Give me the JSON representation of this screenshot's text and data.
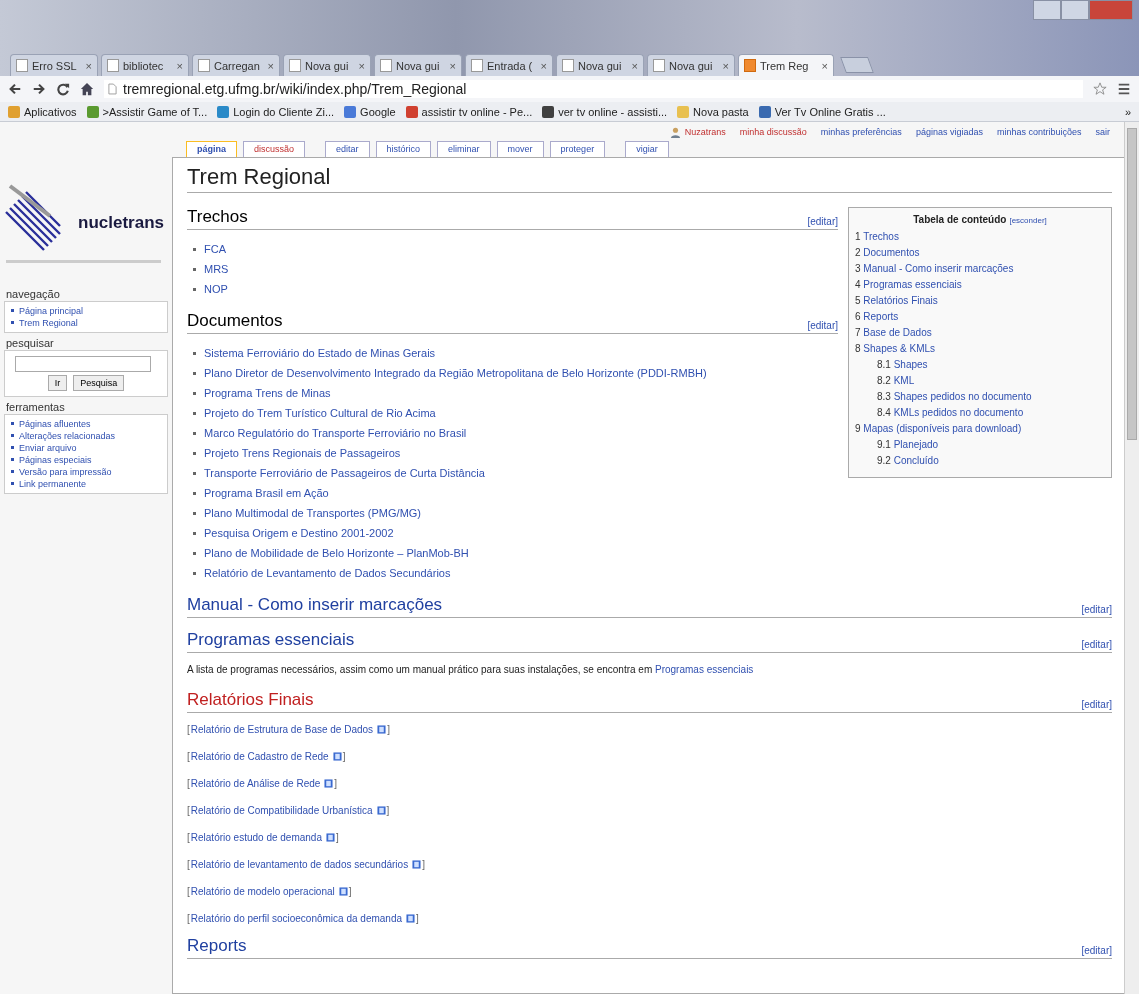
{
  "browser": {
    "tabs": [
      {
        "label": "Erro SSL",
        "selected": false
      },
      {
        "label": "bibliotec",
        "selected": false
      },
      {
        "label": "Carregan",
        "selected": false
      },
      {
        "label": "Nova gui",
        "selected": false
      },
      {
        "label": "Nova gui",
        "selected": false
      },
      {
        "label": "Entrada (",
        "selected": false
      },
      {
        "label": "Nova gui",
        "selected": false
      },
      {
        "label": "Nova gui",
        "selected": false
      },
      {
        "label": "Trem Reg",
        "selected": true
      }
    ],
    "close_mark": "×",
    "url": "tremregional.etg.ufmg.br/wiki/index.php/Trem_Regional",
    "bookmarks": [
      {
        "label": "Aplicativos",
        "color": "#e0a030"
      },
      {
        "label": ">Assistir Game of T...",
        "color": "#5a9a30"
      },
      {
        "label": "Login do Cliente Zi...",
        "color": "#2a8ac8"
      },
      {
        "label": "Google",
        "color": "#4a7ad8"
      },
      {
        "label": "assistir tv online - Pe...",
        "color": "#d04030"
      },
      {
        "label": "ver tv online - assisti...",
        "color": "#404040"
      },
      {
        "label": "Nova pasta",
        "color": "#e8c050"
      },
      {
        "label": "Ver Tv Online Gratis ...",
        "color": "#3a6ab0"
      }
    ],
    "more": "»"
  },
  "personal": [
    {
      "label": "Nuzatrans",
      "missing": true
    },
    {
      "label": "minha discussão",
      "missing": true
    },
    {
      "label": "minhas preferências",
      "missing": false
    },
    {
      "label": "páginas vigiadas",
      "missing": false
    },
    {
      "label": "minhas contribuições",
      "missing": false
    },
    {
      "label": "sair",
      "missing": false
    }
  ],
  "page_tabs": [
    [
      {
        "label": "página",
        "selected": true,
        "missing": false
      },
      {
        "label": "discussão",
        "selected": false,
        "missing": true
      }
    ],
    [
      {
        "label": "editar",
        "selected": false,
        "missing": false
      },
      {
        "label": "histórico",
        "selected": false,
        "missing": false
      },
      {
        "label": "eliminar",
        "selected": false,
        "missing": false
      },
      {
        "label": "mover",
        "selected": false,
        "missing": false
      },
      {
        "label": "proteger",
        "selected": false,
        "missing": false
      }
    ],
    [
      {
        "label": "vigiar",
        "selected": false,
        "missing": false
      }
    ]
  ],
  "logo": {
    "name": "nucletrans"
  },
  "sidebar": [
    {
      "title": "navegação",
      "kind": "links",
      "items": [
        "Página principal",
        "Trem Regional"
      ]
    },
    {
      "title": "pesquisar",
      "kind": "search",
      "buttons": [
        "Ir",
        "Pesquisa"
      ]
    },
    {
      "title": "ferramentas",
      "kind": "links",
      "items": [
        "Páginas afluentes",
        "Alterações relacionadas",
        "Enviar arquivo",
        "Páginas especiais",
        "Versão para impressão",
        "Link permanente"
      ]
    }
  ],
  "title": "Trem Regional",
  "toc": {
    "title": "Tabela de conteúdo",
    "toggle": "[esconder]",
    "items": [
      {
        "number": "1",
        "label": "Trechos"
      },
      {
        "number": "2",
        "label": "Documentos"
      },
      {
        "number": "3",
        "label": "Manual - Como inserir marcações"
      },
      {
        "number": "4",
        "label": "Programas essenciais"
      },
      {
        "number": "5",
        "label": "Relatórios Finais"
      },
      {
        "number": "6",
        "label": "Reports"
      },
      {
        "number": "7",
        "label": "Base de Dados"
      },
      {
        "number": "8",
        "label": "Shapes & KMLs",
        "children": [
          {
            "number": "8.1",
            "label": "Shapes"
          },
          {
            "number": "8.2",
            "label": "KML"
          },
          {
            "number": "8.3",
            "label": "Shapes pedidos no documento"
          },
          {
            "number": "8.4",
            "label": "KMLs pedidos no documento"
          }
        ]
      },
      {
        "number": "9",
        "label": "Mapas (disponíveis para download)",
        "children": [
          {
            "number": "9.1",
            "label": "Planejado"
          },
          {
            "number": "9.2",
            "label": "Concluído"
          }
        ]
      }
    ]
  },
  "sections": [
    {
      "title": "Trechos",
      "linked": false,
      "edit": "[editar]",
      "kind": "bullets",
      "items": [
        "FCA",
        "MRS",
        "NOP"
      ]
    },
    {
      "title": "Documentos",
      "linked": false,
      "edit": "[editar]",
      "kind": "bullets",
      "items": [
        "Sistema Ferroviário do Estado de Minas Gerais",
        "Plano Diretor de Desenvolvimento Integrado da Região Metropolitana de Belo Horizonte (PDDI-RMBH)",
        "Programa Trens de Minas",
        "Projeto do Trem Turístico Cultural de Rio Acima",
        "Marco Regulatório do Transporte Ferroviário no Brasil",
        "Projeto Trens Regionais de Passageiros",
        "Transporte Ferroviário de Passageiros de Curta Distância",
        "Programa Brasil em Ação",
        "Plano Multimodal de Transportes (PMG/MG)",
        "Pesquisa Origem e Destino 2001-2002",
        "Plano de Mobilidade de Belo Horizonte – PlanMob-BH",
        "Relatório de Levantamento de Dados Secundários"
      ]
    },
    {
      "title": "Manual - Como inserir marcações",
      "linked": true,
      "missing": false,
      "edit": "[editar]",
      "kind": "empty"
    },
    {
      "title": "Programas essenciais",
      "linked": true,
      "missing": false,
      "edit": "[editar]",
      "kind": "paragraph",
      "text": "A lista de programas necessários, assim como um manual prático para suas instalações, se encontra em ",
      "link": "Programas essenciais"
    },
    {
      "title": "Relatórios Finais",
      "linked": true,
      "missing": true,
      "edit": "[editar]",
      "kind": "bracket_links",
      "open": "[",
      "close": "]",
      "items": [
        "Relatório de Estrutura de Base de Dados",
        "Relatório de Cadastro de Rede",
        "Relatório de Análise de Rede",
        "Relatório de Compatibilidade Urbanística",
        "Relatório estudo de demanda",
        "Relatório de levantamento de dados secundários",
        "Relatório de modelo operacional",
        "Relatório do perfil socioeconômica da demanda"
      ]
    },
    {
      "title": "Reports",
      "linked": true,
      "missing": false,
      "edit": "[editar]",
      "kind": "empty"
    }
  ]
}
